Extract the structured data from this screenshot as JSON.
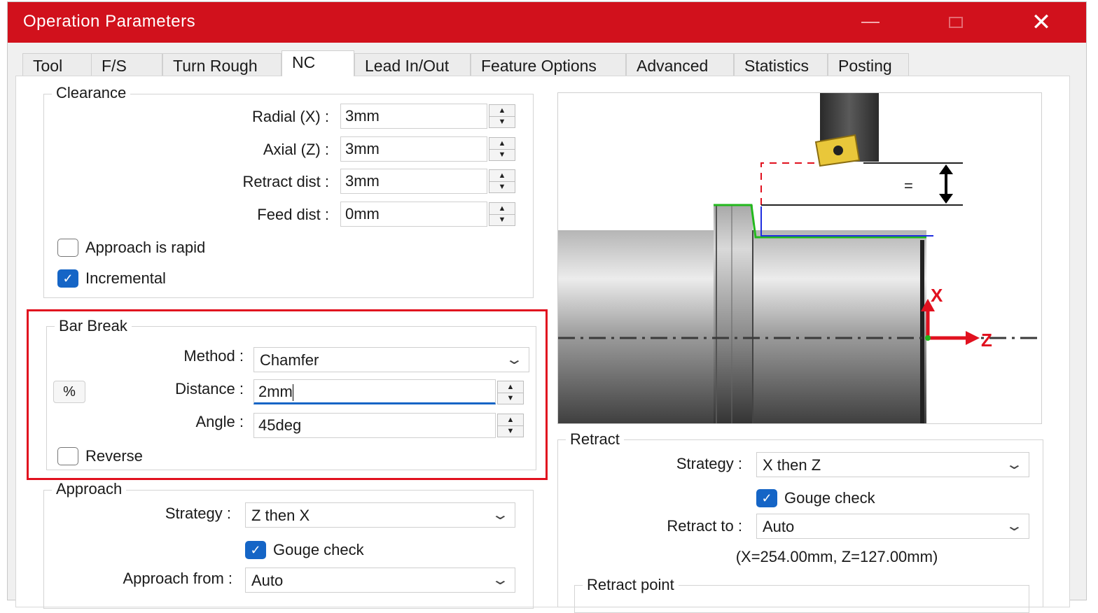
{
  "window": {
    "title": "Operation Parameters"
  },
  "tabs": [
    "Tool",
    "F/S",
    "Turn Rough",
    "NC",
    "Lead In/Out",
    "Feature Options",
    "Advanced",
    "Statistics",
    "Posting"
  ],
  "clearance": {
    "title": "Clearance",
    "radial_label": "Radial (X) :",
    "radial_value": "3mm",
    "axial_label": "Axial (Z) :",
    "axial_value": "3mm",
    "retract_label": "Retract dist :",
    "retract_value": "3mm",
    "feed_label": "Feed dist :",
    "feed_value": "0mm",
    "approach_rapid": "Approach is rapid",
    "incremental": "Incremental"
  },
  "bar_break": {
    "title": "Bar Break",
    "method_label": "Method :",
    "method_value": "Chamfer",
    "percent_btn": "%",
    "distance_label": "Distance :",
    "distance_value": "2mm",
    "angle_label": "Angle :",
    "angle_value": "45deg",
    "reverse": "Reverse"
  },
  "approach": {
    "title": "Approach",
    "strategy_label": "Strategy :",
    "strategy_value": "Z then X",
    "gouge_check": "Gouge check",
    "from_label": "Approach from :",
    "from_value": "Auto"
  },
  "retract": {
    "title": "Retract",
    "strategy_label": "Strategy :",
    "strategy_value": "X then Z",
    "gouge_check": "Gouge check",
    "to_label": "Retract to :",
    "to_value": "Auto",
    "coords": "(X=254.00mm, Z=127.00mm)",
    "point_title": "Retract point"
  },
  "preview": {
    "x_axis": "X",
    "z_axis": "Z"
  },
  "colors": {
    "titlebar": "#d1111c",
    "highlight": "#e1111f",
    "check": "#1565c6",
    "toolpath_green": "#22b81c",
    "toolpath_blue": "#1f2ee0"
  }
}
